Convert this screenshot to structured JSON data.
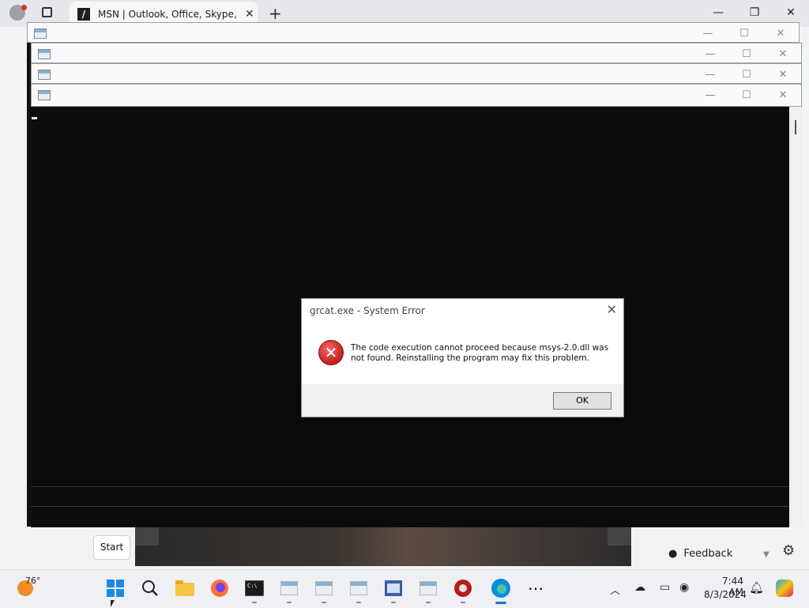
{
  "browser": {
    "tab_title": "MSN | Outlook, Office, Skype, Bing",
    "new_tab": "+",
    "minimize": "—",
    "restore": "❐",
    "close": "✕"
  },
  "dialog": {
    "title": "grcat.exe - System Error",
    "message": "The code execution cannot proceed because msys-2.0.dll was not found. Reinstalling the program may fix this problem.",
    "ok_label": "OK"
  },
  "page": {
    "start_label": "Start",
    "feedback_label": "Feedback"
  },
  "taskbar": {
    "weather_temp": "76°",
    "time": "7:44 AM",
    "date": "8/3/2024",
    "apps": [
      "start-icon",
      "search-icon",
      "file-explorer-icon",
      "firefox-icon",
      "terminal-icon",
      "console-window-icon",
      "console-window-icon",
      "console-window-icon",
      "ide-icon",
      "console-window-icon",
      "media-icon",
      "edge-icon",
      "more-icon"
    ]
  }
}
